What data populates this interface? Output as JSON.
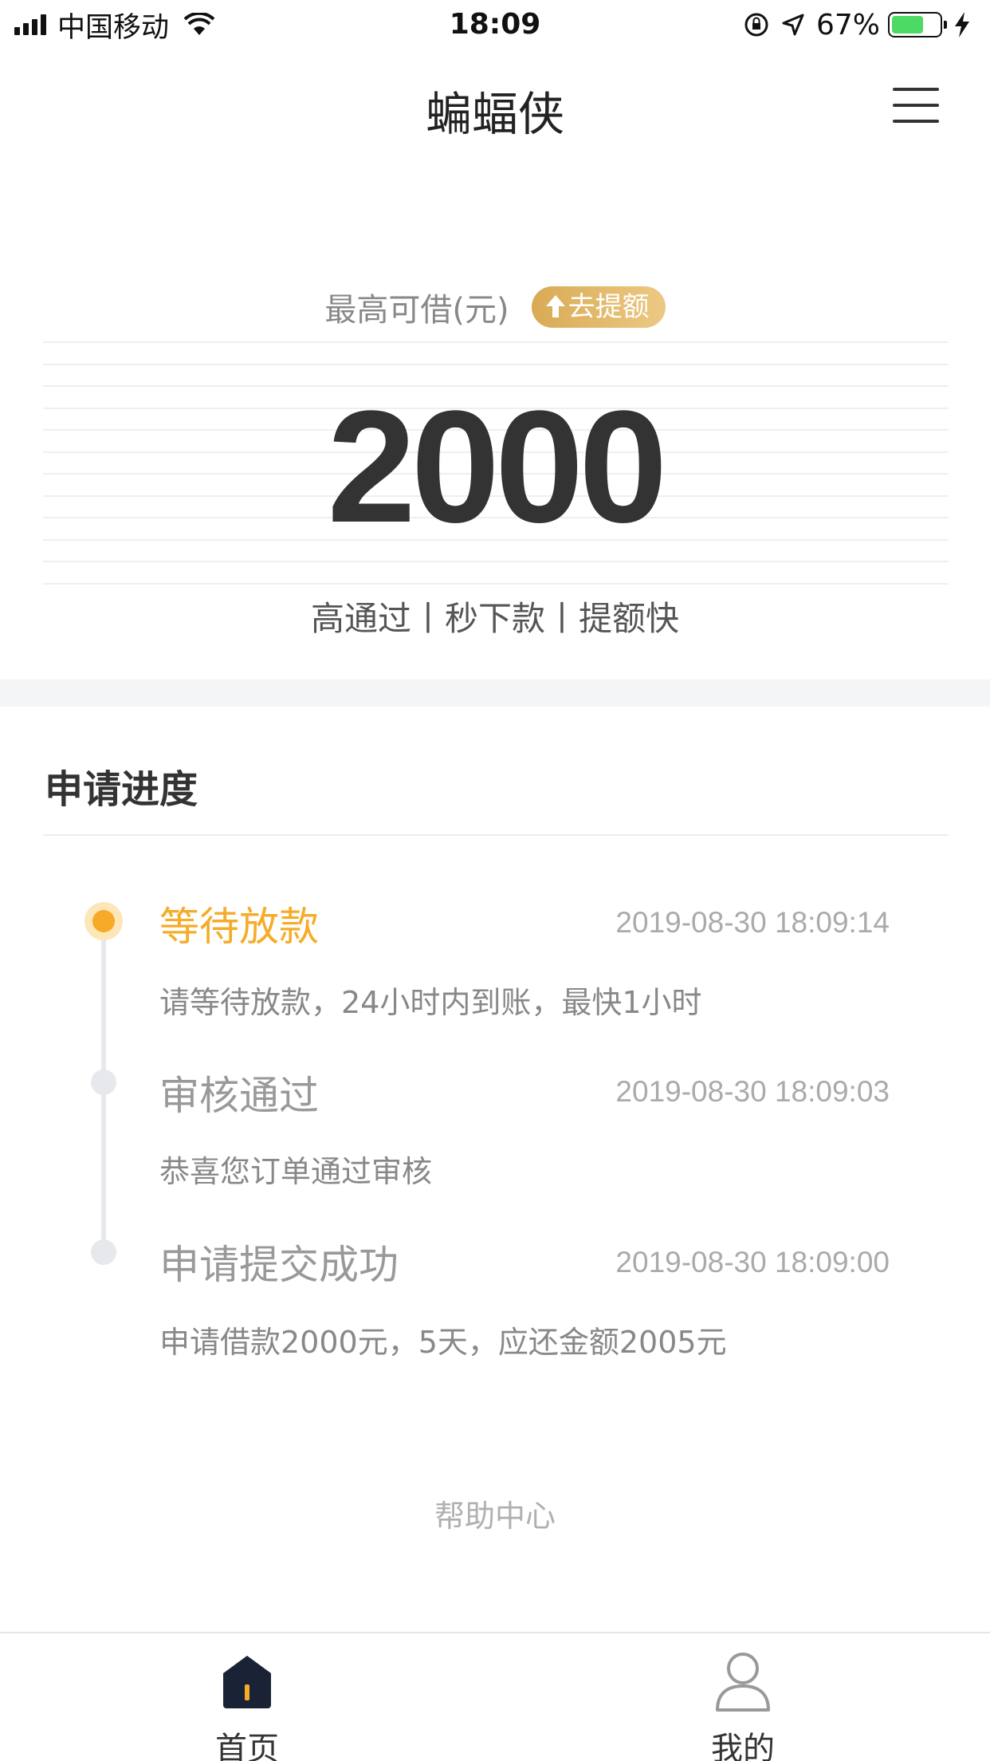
{
  "status_bar": {
    "carrier": "中国移动",
    "time": "18:09",
    "battery": "67%",
    "battery_level": 0.67,
    "icons": [
      "signal-icon",
      "wifi-icon",
      "orientation-lock-icon",
      "location-icon",
      "battery-icon",
      "charging-icon"
    ]
  },
  "nav": {
    "title": "蝙蝠侠",
    "menu_icon": "hamburger-menu-icon"
  },
  "hero": {
    "max_label": "最高可借(元)",
    "raise_label": "去提额",
    "raise_icon": "arrow-up-icon",
    "amount": "2000",
    "features": "高通过丨秒下款丨提额快"
  },
  "progress": {
    "title": "申请进度",
    "steps": [
      {
        "title": "等待放款",
        "time": "2019-08-30 18:09:14",
        "desc": "请等待放款，24小时内到账，最快1小时",
        "active": true
      },
      {
        "title": "审核通过",
        "time": "2019-08-30 18:09:03",
        "desc": "恭喜您订单通过审核",
        "active": false
      },
      {
        "title": "申请提交成功",
        "time": "2019-08-30 18:09:00",
        "desc": "申请借款2000元，5天，应还金额2005元",
        "active": false
      }
    ]
  },
  "help_center": "帮助中心",
  "tabs": [
    {
      "label": "首页",
      "icon": "home-icon",
      "selected": true
    },
    {
      "label": "我的",
      "icon": "user-icon",
      "selected": false
    }
  ],
  "colors": {
    "accent": "#f5ac29",
    "gold_button": "#e0b261",
    "text_dark": "#333333",
    "text_muted": "#999999",
    "nav_icon_dark": "#1a2236"
  }
}
